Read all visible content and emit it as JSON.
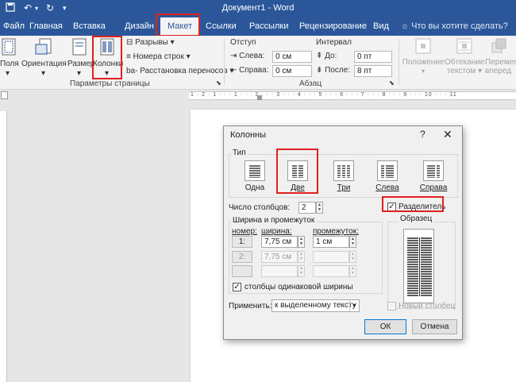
{
  "titlebar": {
    "document_title": "Документ1 - Word"
  },
  "tabs": [
    {
      "label": "Файл"
    },
    {
      "label": "Главная"
    },
    {
      "label": "Вставка"
    },
    {
      "label": "Дизайн"
    },
    {
      "label": "Макет"
    },
    {
      "label": "Ссылки"
    },
    {
      "label": "Рассылки"
    },
    {
      "label": "Рецензирование"
    },
    {
      "label": "Вид"
    }
  ],
  "tell_me": "Что вы хотите сделать?",
  "ribbon": {
    "fields_label": "Поля",
    "orientation_label": "Ориентация",
    "size_label": "Размер",
    "columns_label": "Колонки",
    "breaks_label": "Разрывы",
    "line_numbers_label": "Номера строк",
    "hyphenation_label": "Расстановка переносов",
    "page_setup_group": "Параметры страницы",
    "indent_head": "Отступ",
    "indent_left_label": "Слева:",
    "indent_left_value": "0 см",
    "indent_right_label": "Справа:",
    "indent_right_value": "0 см",
    "spacing_head": "Интервал",
    "spacing_before_label": "До:",
    "spacing_before_value": "0 пт",
    "spacing_after_label": "После:",
    "spacing_after_value": "8 пт",
    "paragraph_group": "Абзац",
    "position_label": "Положение",
    "wrap_label_1": "Обтекание",
    "wrap_label_2": "текстом",
    "forward_label_1": "Перемести",
    "forward_label_2": "вперед"
  },
  "ruler": {
    "marks": "1 · 2 · 1 · · · 1 · · · 2 · · · 3 · · · 4 · · · 5 · · · 6 · · · 7 · · · 8 · · · 9 · · · 10 · · · 11"
  },
  "dialog": {
    "title": "Колонны",
    "help": "?",
    "close": "✕",
    "type_label": "Тип",
    "presets": [
      {
        "label": "Одна"
      },
      {
        "label": "Две"
      },
      {
        "label": "Три"
      },
      {
        "label": "Слева"
      },
      {
        "label": "Справа"
      }
    ],
    "num_columns_label": "Число столбцов:",
    "num_columns_value": "2",
    "separator_label": "Разделитель",
    "separator_checked": true,
    "width_spacing_label": "Ширина и промежуток",
    "col_number_head": "номер:",
    "col_width_head": "ширина:",
    "col_spacing_head": "промежуток:",
    "rows": [
      {
        "num": "1:",
        "width": "7,75 см",
        "spacing": "1 см"
      },
      {
        "num": "2:",
        "width": "7,75 см",
        "spacing": ""
      },
      {
        "num": "",
        "width": "",
        "spacing": ""
      }
    ],
    "equal_width_label": "столбцы одинаковой ширины",
    "equal_width_checked": true,
    "sample_label": "Образец",
    "apply_label": "Применить:",
    "apply_value": "к выделенному тексту",
    "new_column_label": "Новый столбец",
    "ok_label": "ОК",
    "cancel_label": "Отмена"
  }
}
